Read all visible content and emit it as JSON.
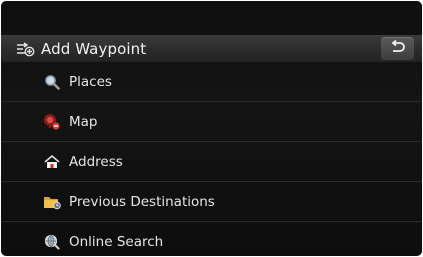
{
  "header": {
    "title": "Add Waypoint",
    "icon": "add-waypoint-icon",
    "back_icon": "back-arrow-icon"
  },
  "menu": {
    "items": [
      {
        "label": "Places",
        "icon": "magnifier-icon"
      },
      {
        "label": "Map",
        "icon": "map-pin-icon"
      },
      {
        "label": "Address",
        "icon": "house-icon"
      },
      {
        "label": "Previous Destinations",
        "icon": "folder-icon"
      },
      {
        "label": "Online Search",
        "icon": "globe-search-icon"
      }
    ]
  },
  "colors": {
    "background": "#111111",
    "header": "#2f2f2f",
    "text": "#e6e6e6"
  }
}
